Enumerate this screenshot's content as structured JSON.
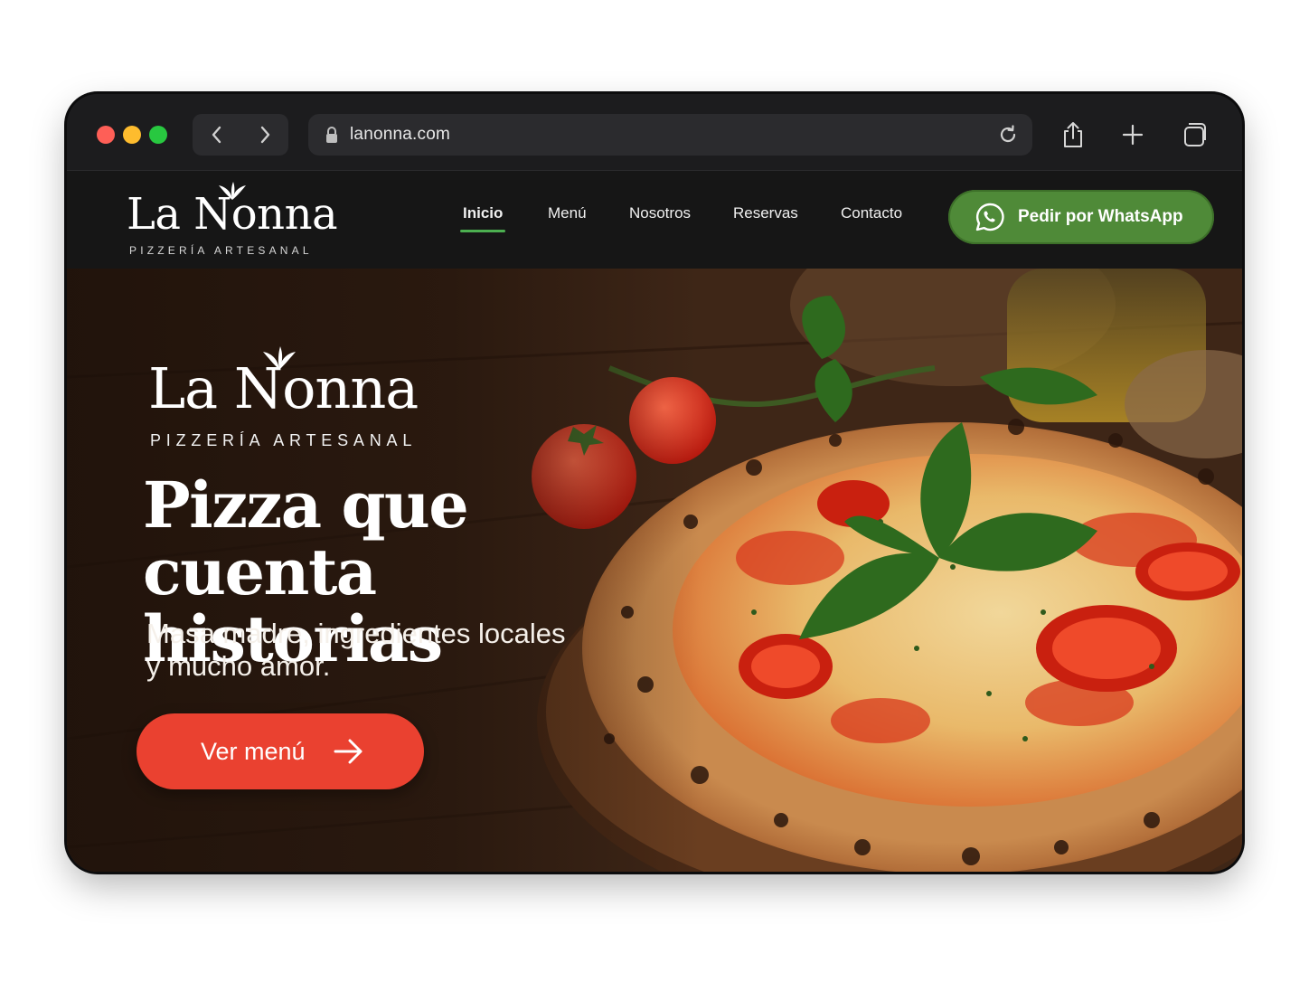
{
  "browser": {
    "url": "lanonna.com"
  },
  "header": {
    "logo": {
      "name": "La Nonna",
      "tagline": "PIZZERÍA ARTESANAL"
    },
    "nav": [
      {
        "label": "Inicio",
        "active": true
      },
      {
        "label": "Menú",
        "active": false
      },
      {
        "label": "Nosotros",
        "active": false
      },
      {
        "label": "Reservas",
        "active": false
      },
      {
        "label": "Contacto",
        "active": false
      }
    ],
    "whatsapp_button": "Pedir por WhatsApp"
  },
  "hero": {
    "logo": {
      "name": "La Nonna",
      "tagline": "PIZZERÍA ARTESANAL"
    },
    "title_line1": "Pizza que",
    "title_line2": "cuenta historias",
    "subtitle_line1": "Masa madre, ingredientes locales",
    "subtitle_line2": "y mucho amor.",
    "cta_label": "Ver menú"
  },
  "colors": {
    "accent_green": "#4f8a38",
    "cta_red": "#ea4130",
    "header_bg": "#161616"
  },
  "icons": [
    "back-icon",
    "forward-icon",
    "lock-icon",
    "reload-icon",
    "share-icon",
    "new-tab-icon",
    "tabs-overview-icon",
    "leaf-icon",
    "whatsapp-icon",
    "arrow-right-icon"
  ]
}
